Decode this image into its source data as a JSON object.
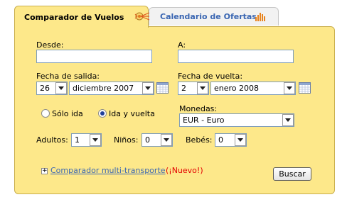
{
  "tabs": {
    "active_label": "Comparador de Vuelos",
    "inactive_label": "Calendario de Ofertas",
    "active_icon": "plane-icon",
    "inactive_icon": "bar-chart-icon"
  },
  "form": {
    "from_label": "Desde:",
    "from_value": "",
    "to_label": "A:",
    "to_value": "",
    "departure_label": "Fecha de salida:",
    "departure_day": "26",
    "departure_month": "diciembre 2007",
    "return_label": "Fecha de vuelta:",
    "return_day": "2",
    "return_month": "enero 2008",
    "trip_oneway_label": "Sólo ida",
    "trip_return_label": "Ida y vuelta",
    "trip_selected": "Ida y vuelta",
    "currency_label": "Monedas:",
    "currency_value": "EUR - Euro",
    "adults_label": "Adultos:",
    "adults_value": "1",
    "children_label": "Niños:",
    "children_value": "0",
    "babies_label": "Bebés:",
    "babies_value": "0",
    "multi_transport_link": "Comparador multi-transporte",
    "new_badge": "(¡Nuevo!)",
    "search_button": "Buscar"
  },
  "colors": {
    "panel_bg": "#fde88a",
    "panel_border": "#c9ae4c",
    "link": "#3a66b2",
    "new_badge": "#e30000"
  }
}
